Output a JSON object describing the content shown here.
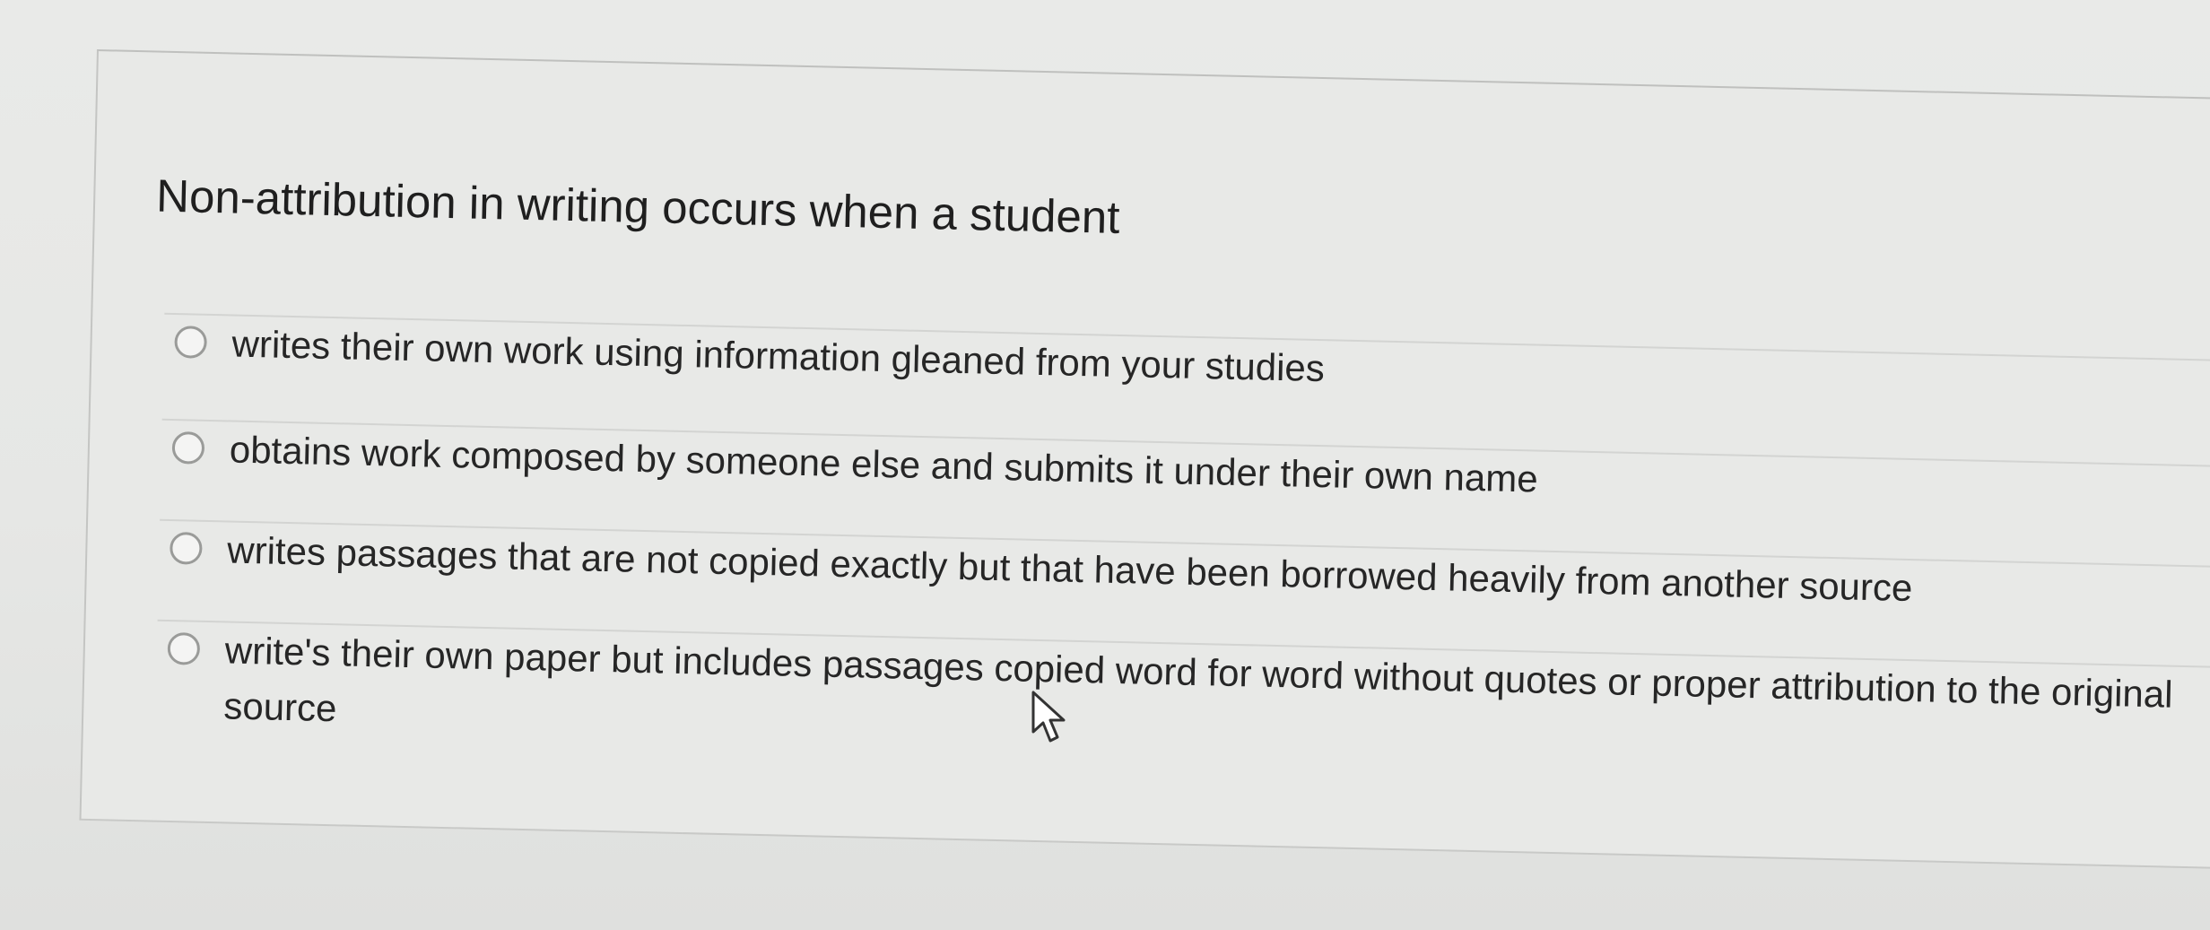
{
  "question": {
    "text": "Non-attribution in writing occurs when a student"
  },
  "choices": [
    {
      "label": "writes their own work using information gleaned from your studies",
      "selected": false
    },
    {
      "label": "obtains work composed by someone else and submits it under their own name",
      "selected": false
    },
    {
      "label": "writes passages that are not copied exactly but that have been borrowed heavily from another source",
      "selected": false
    },
    {
      "label": "write's their own paper but includes passages copied word for word without quotes or proper attribution to the original source",
      "selected": false
    }
  ],
  "icons": {
    "cursor": "mouse-pointer-icon",
    "radio": "radio-button-icon"
  },
  "colors": {
    "background": "#e6e7e5",
    "text": "#1f1f1f",
    "radio_border": "#9a9b99"
  }
}
